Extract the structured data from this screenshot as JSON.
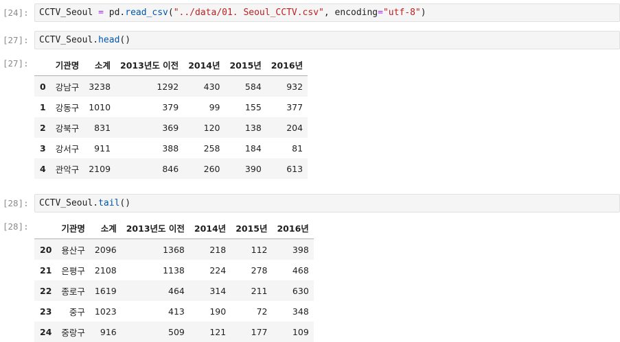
{
  "cells": {
    "c24": {
      "prompt": "[24]:",
      "code": {
        "var": "CCTV_Seoul",
        "assign": " = ",
        "mod": "pd",
        "dot": ".",
        "func": "read_csv",
        "open": "(",
        "arg": "\"../data/01. Seoul_CCTV.csv\"",
        "comma": ", ",
        "kw": "encoding",
        "eq": "=",
        "kwval": "\"utf-8\"",
        "close": ")"
      }
    },
    "c27": {
      "prompt": "[27]:",
      "code": {
        "var": "CCTV_Seoul",
        "dot": ".",
        "func": "head",
        "call": "()"
      },
      "out_prompt": "[27]:"
    },
    "c28": {
      "prompt": "[28]:",
      "code": {
        "var": "CCTV_Seoul",
        "dot": ".",
        "func": "tail",
        "call": "()"
      },
      "out_prompt": "[28]:"
    }
  },
  "columns": [
    "기관명",
    "소계",
    "2013년도 이전",
    "2014년",
    "2015년",
    "2016년"
  ],
  "head_rows": [
    {
      "idx": "0",
      "vals": [
        "강남구",
        "3238",
        "1292",
        "430",
        "584",
        "932"
      ]
    },
    {
      "idx": "1",
      "vals": [
        "강동구",
        "1010",
        "379",
        "99",
        "155",
        "377"
      ]
    },
    {
      "idx": "2",
      "vals": [
        "강북구",
        "831",
        "369",
        "120",
        "138",
        "204"
      ]
    },
    {
      "idx": "3",
      "vals": [
        "강서구",
        "911",
        "388",
        "258",
        "184",
        "81"
      ]
    },
    {
      "idx": "4",
      "vals": [
        "관악구",
        "2109",
        "846",
        "260",
        "390",
        "613"
      ]
    }
  ],
  "tail_rows": [
    {
      "idx": "20",
      "vals": [
        "용산구",
        "2096",
        "1368",
        "218",
        "112",
        "398"
      ]
    },
    {
      "idx": "21",
      "vals": [
        "은평구",
        "2108",
        "1138",
        "224",
        "278",
        "468"
      ]
    },
    {
      "idx": "22",
      "vals": [
        "종로구",
        "1619",
        "464",
        "314",
        "211",
        "630"
      ]
    },
    {
      "idx": "23",
      "vals": [
        "중구",
        "1023",
        "413",
        "190",
        "72",
        "348"
      ]
    },
    {
      "idx": "24",
      "vals": [
        "중랑구",
        "916",
        "509",
        "121",
        "177",
        "109"
      ]
    }
  ]
}
